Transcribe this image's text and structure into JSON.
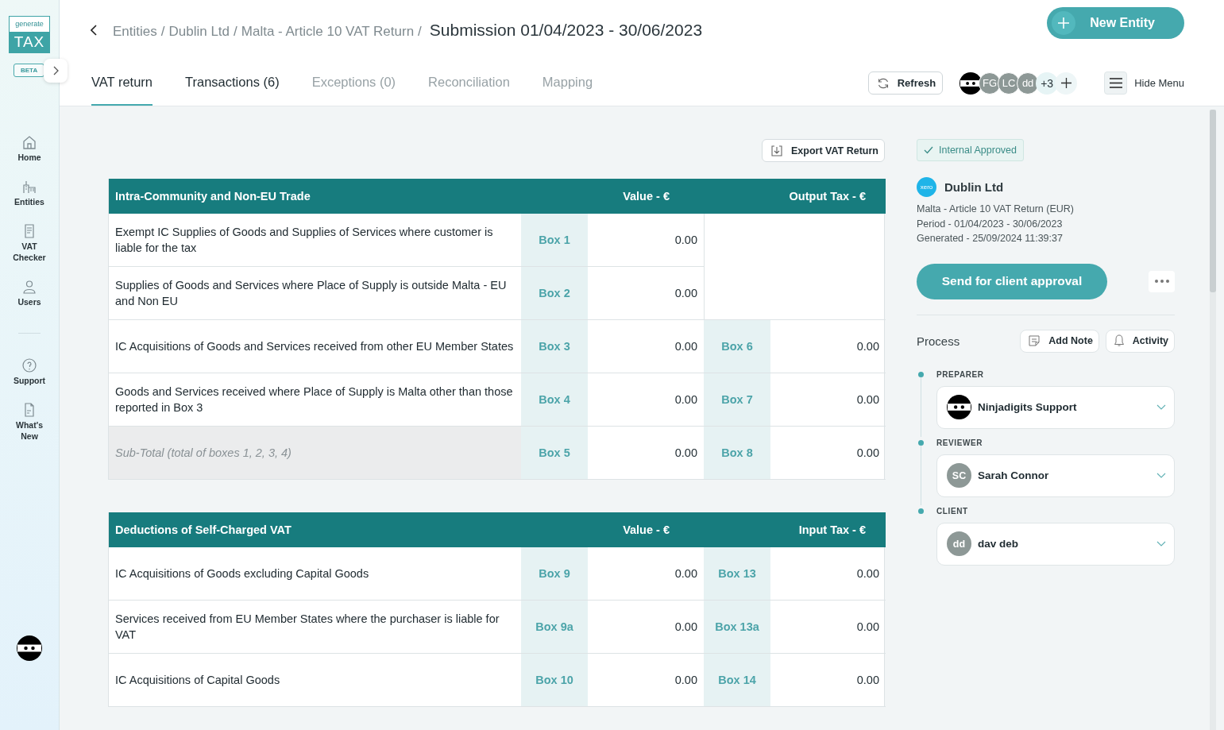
{
  "sidebar": {
    "logo": {
      "top": "generate",
      "bottom": "TAX"
    },
    "badge": "BETA",
    "sections": [
      [
        {
          "label": "Home",
          "kind": "home"
        },
        {
          "label": "Entities",
          "kind": "entities"
        },
        {
          "label": "VAT Checker",
          "kind": "checker"
        },
        {
          "label": "Users",
          "kind": "users"
        }
      ],
      [
        {
          "label": "Support",
          "kind": "support"
        },
        {
          "label": "What's New",
          "kind": "news"
        }
      ]
    ]
  },
  "header": {
    "breadcrumb": [
      {
        "label": "Entities",
        "separator": "/"
      },
      {
        "label": "Dublin Ltd",
        "separator": "/"
      },
      {
        "label": "Malta - Article 10 VAT Return",
        "separator": "/"
      }
    ],
    "title": "Submission 01/04/2023 - 30/06/2023",
    "new_button": "New Entity",
    "tabs": [
      {
        "label": "VAT return",
        "selected": true,
        "disabled": false
      },
      {
        "label": "Transactions (6)",
        "selected": false,
        "disabled": false
      },
      {
        "label": "Exceptions (0)",
        "selected": false,
        "disabled": true
      },
      {
        "label": "Reconciliation",
        "selected": false,
        "disabled": true
      },
      {
        "label": "Mapping",
        "selected": false,
        "disabled": true
      }
    ],
    "refresh_button": "Refresh",
    "avatars": [
      {
        "kind": "ninja"
      },
      {
        "kind": "initials",
        "text": "FG"
      },
      {
        "kind": "initials",
        "text": "LC"
      },
      {
        "kind": "initials",
        "text": "dd"
      },
      {
        "kind": "more",
        "text": "+3"
      },
      {
        "kind": "add"
      }
    ],
    "menu_button": "Hide Menu"
  },
  "export_button": "Export VAT Return",
  "tables": [
    {
      "title": "Intra-Community and Non-EU Trade",
      "columns": [
        "Value - €",
        "Output Tax - €"
      ],
      "rows": [
        {
          "kind": "item",
          "label": "Exempt IC Supplies of Goods and Supplies of Services where customer is liable for the tax",
          "box": "Box 1",
          "value": "0.00"
        },
        {
          "kind": "item",
          "label": "Supplies of Goods and Services where Place of Supply is outside Malta - EU and Non EU",
          "box": "Box 2",
          "value": "0.00"
        },
        {
          "kind": "item",
          "label": "IC Acquisitions of Goods and Services received from other EU Member States",
          "box": "Box 3",
          "value": "0.00",
          "tax_box": "Box 6",
          "tax": "0.00"
        },
        {
          "kind": "item",
          "label": "Goods and Services received where Place of Supply is Malta other than those reported in Box 3",
          "box": "Box 4",
          "value": "0.00",
          "tax_box": "Box 7",
          "tax": "0.00"
        },
        {
          "kind": "subtotal",
          "label": "Sub-Total (total of boxes 1, 2, 3, 4)",
          "box": "Box 5",
          "value": "0.00",
          "tax_box": "Box 8",
          "tax": "0.00"
        }
      ]
    },
    {
      "title": "Deductions of Self-Charged VAT",
      "columns": [
        "Value - €",
        "Input Tax - €"
      ],
      "rows": [
        {
          "kind": "item",
          "label": "IC Acquisitions of Goods excluding Capital Goods",
          "box": "Box 9",
          "value": "0.00",
          "tax_box": "Box 13",
          "tax": "0.00"
        },
        {
          "kind": "item",
          "label": "Services received from EU Member States where the purchaser is liable for VAT",
          "box": "Box 9a",
          "value": "0.00",
          "tax_box": "Box 13a",
          "tax": "0.00"
        },
        {
          "kind": "item",
          "label": "IC Acquisitions of Capital Goods",
          "box": "Box 10",
          "value": "0.00",
          "tax_box": "Box 14",
          "tax": "0.00"
        }
      ]
    }
  ],
  "panel": {
    "status": "Internal Approved",
    "entity": {
      "logo_text": "xero",
      "name": "Dublin Ltd",
      "details": [
        "Malta - Article 10 VAT Return (EUR)",
        "Period - 01/04/2023 - 30/06/2023",
        "Generated - 25/09/2024 11:39:37"
      ]
    },
    "send_button": "Send for client approval",
    "process_title": "Process",
    "note_button": "Add Note",
    "activity_button": "Activity",
    "steps": [
      {
        "role": "PREPARER",
        "name": "Ninjadigits Support",
        "kind": "ninja"
      },
      {
        "role": "REVIEWER",
        "name": "Sarah Connor",
        "kind": "initials",
        "initials": "SC"
      },
      {
        "role": "CLIENT",
        "name": "dav deb",
        "kind": "initials",
        "initials": "dd"
      }
    ]
  }
}
